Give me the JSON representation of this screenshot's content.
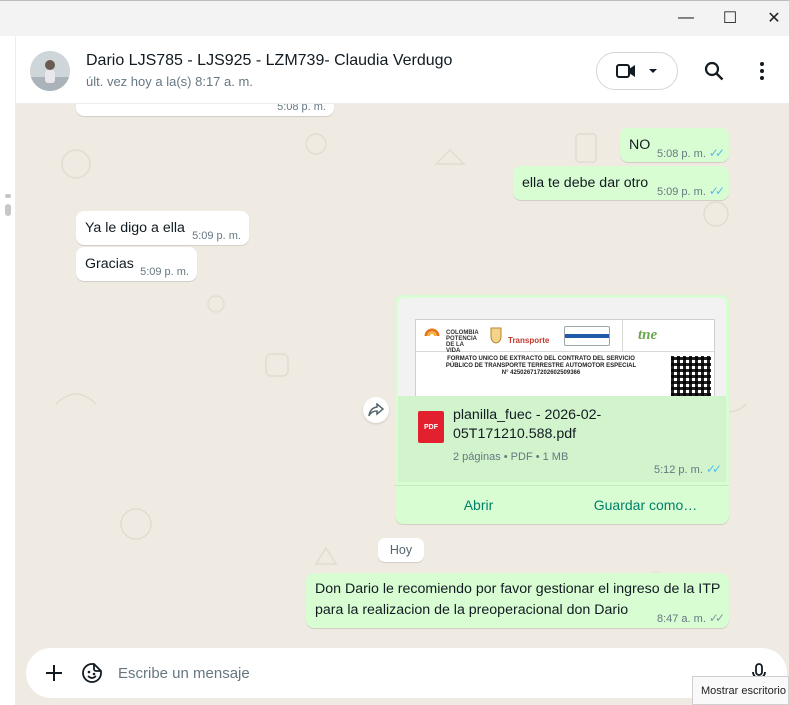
{
  "window": {
    "minimize_glyph": "—",
    "maximize_glyph": "☐",
    "close_glyph": "✕"
  },
  "header": {
    "contact_name": "Dario LJS785 - LJS925 - LZM739- Claudia Verdugo",
    "last_seen": "últ. vez hoy a la(s) 8:17 a. m.",
    "icons": [
      "video-call-icon",
      "chevron-down-icon",
      "search-icon",
      "menu-icon"
    ]
  },
  "messages": [
    {
      "direction": "in",
      "text": "",
      "time": "5:08 p. m."
    },
    {
      "direction": "out",
      "text": "NO",
      "time": "5:08 p. m.",
      "status": "read"
    },
    {
      "direction": "out",
      "text": "ella te debe dar otro",
      "time": "5:09 p. m.",
      "status": "read"
    },
    {
      "direction": "in",
      "text": "Ya le digo a ella",
      "time": "5:09 p. m."
    },
    {
      "direction": "in",
      "text": "Gracias",
      "time": "5:09 p. m."
    }
  ],
  "document": {
    "preview": {
      "logo_left": "COLOMBIA POTENCIA DE LA VIDA",
      "logo_mid": "Transporte",
      "logo_right": "tne",
      "heading_line1": "FORMATO UNICO DE EXTRACTO DEL CONTRATO DEL SERVICIO",
      "heading_line2": "PÚBLICO DE TRANSPORTE TERRESTRE AUTOMOTOR ESPECIAL",
      "heading_line3": "N° 425026717202602509366"
    },
    "file_badge": "PDF",
    "file_name": "planilla_fuec - 2026-02-05T171210.588.pdf",
    "details": "2 páginas • PDF • 1 MB",
    "time": "5:12 p. m.",
    "status": "read",
    "open_label": "Abrir",
    "save_label": "Guardar como…"
  },
  "day_separator": "Hoy",
  "last_message": {
    "direction": "out",
    "text": "Don Dario le recomiendo por favor gestionar el ingreso de la ITP para la realizacion de la preoperacional don Dario",
    "time": "8:47 a. m.",
    "status": "delivered"
  },
  "composer": {
    "placeholder": "Escribe un mensaje",
    "icons": [
      "plus-icon",
      "sticker-icon",
      "microphone-icon"
    ]
  },
  "tooltip": "Mostrar escritorio",
  "colors": {
    "chat_background": "#efeae2",
    "outgoing_bubble": "#d9fdd3",
    "incoming_bubble": "#ffffff",
    "accent": "#008069",
    "read_ticks": "#53bdeb",
    "pdf_red": "#e2202e"
  }
}
